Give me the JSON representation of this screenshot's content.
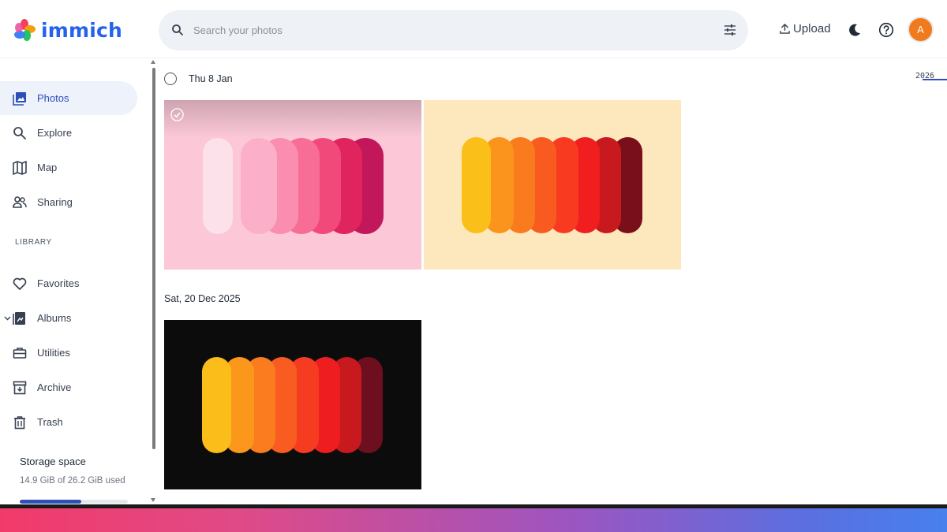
{
  "app": {
    "name": "immich",
    "brand_color": "#2563eb"
  },
  "header": {
    "search_placeholder": "Search your photos",
    "upload_label": "Upload",
    "avatar_initial": "A"
  },
  "sidebar": {
    "items": [
      {
        "label": "Photos",
        "icon": "photos-icon",
        "active": true
      },
      {
        "label": "Explore",
        "icon": "search-icon"
      },
      {
        "label": "Map",
        "icon": "map-icon"
      },
      {
        "label": "Sharing",
        "icon": "people-icon"
      }
    ],
    "library_label": "LIBRARY",
    "library_items": [
      {
        "label": "Favorites",
        "icon": "heart-icon"
      },
      {
        "label": "Albums",
        "icon": "album-icon",
        "expandable": true
      },
      {
        "label": "Utilities",
        "icon": "toolbox-icon"
      },
      {
        "label": "Archive",
        "icon": "archive-icon"
      },
      {
        "label": "Trash",
        "icon": "trash-icon"
      }
    ],
    "storage": {
      "title": "Storage space",
      "used_text": "14.9 GiB of 26.2 GiB used",
      "used_fraction": 0.57
    }
  },
  "timeline": {
    "groups": [
      {
        "date": "Thu 8 Jan"
      },
      {
        "date": "Sat, 20 Dec 2025"
      }
    ],
    "year_marker": "2026"
  }
}
